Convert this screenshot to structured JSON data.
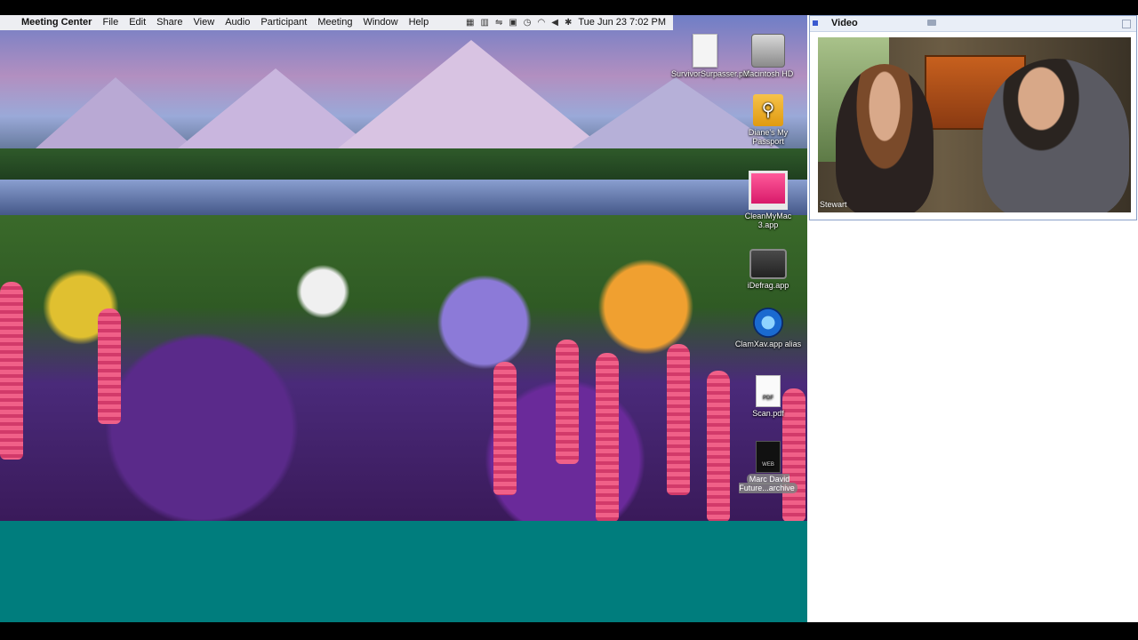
{
  "menubar": {
    "app_name": "Meeting Center",
    "menus": [
      "File",
      "Edit",
      "Share",
      "View",
      "Audio",
      "Participant",
      "Meeting",
      "Window",
      "Help"
    ],
    "clock": "Tue Jun 23  7:02 PM"
  },
  "desktop_icons": [
    {
      "label": "SurvivorSurpasser.pdf",
      "icon": "pdf-document-icon"
    },
    {
      "label": "Macintosh HD",
      "icon": "hard-drive-icon"
    },
    {
      "label": "Diane's My Passport",
      "icon": "usb-drive-icon"
    },
    {
      "label": "CleanMyMac 3.app",
      "icon": "imac-app-icon"
    },
    {
      "label": "iDefrag.app",
      "icon": "defrag-app-icon"
    },
    {
      "label": "ClamXav.app alias",
      "icon": "clamxav-app-icon"
    },
    {
      "label": "Scan.pdf",
      "icon": "pdf-file-icon"
    },
    {
      "label": "Marc David Future...archive",
      "icon": "webarchive-icon"
    }
  ],
  "video_panel": {
    "title": "Video",
    "participant_name": "Stewart"
  },
  "colors": {
    "teal_background": "#007d7d",
    "window_titlebar": "#e9eef7"
  }
}
